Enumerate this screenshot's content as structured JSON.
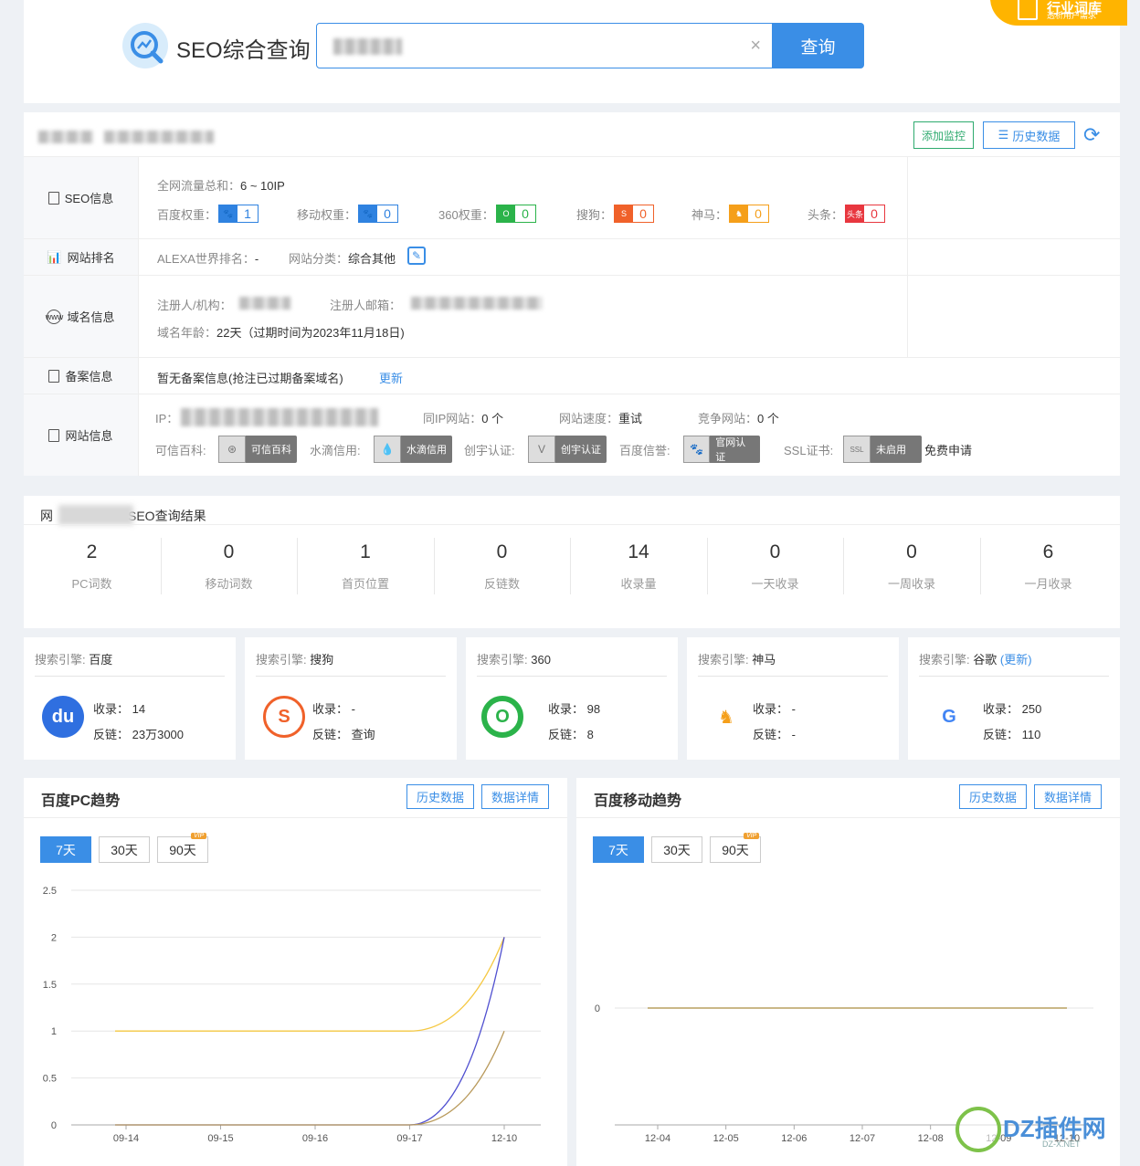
{
  "header": {
    "title": "SEO综合查询",
    "search_value": "",
    "clear_icon": "×",
    "search_button": "查询",
    "industry_badge_title": "行业词库",
    "industry_badge_sub": "透析用户需求"
  },
  "info": {
    "add_monitor": "添加监控",
    "history": "历史数据",
    "refresh_icon": "⟳",
    "seo_label": "SEO信息",
    "traffic_label": "全网流量总和：",
    "traffic_value": "6 ~ 10IP",
    "weights": [
      {
        "label": "百度权重：",
        "value": "1",
        "color": "#2f82e0",
        "icon": "baidu-paw-icon"
      },
      {
        "label": "移动权重：",
        "value": "0",
        "color": "#2f82e0",
        "icon": "baidu-paw-icon"
      },
      {
        "label": "360权重：",
        "value": "0",
        "color": "#2bb34a",
        "icon": "360-icon"
      },
      {
        "label": "搜狗：",
        "value": "0",
        "color": "#f0612a",
        "icon": "sogou-icon"
      },
      {
        "label": "神马：",
        "value": "0",
        "color": "#f59f1a",
        "icon": "shenma-icon"
      },
      {
        "label": "头条：",
        "value": "0",
        "color": "#e8373f",
        "icon": "toutiao-icon"
      }
    ],
    "rank_label": "网站排名",
    "alexa_label": "ALEXA世界排名：",
    "alexa_value": "-",
    "category_label": "网站分类：",
    "category_value": "综合其他",
    "domain_label": "域名信息",
    "registrant_label": "注册人/机构：",
    "email_label": "注册人邮箱：",
    "age_label": "域名年龄：",
    "age_value": "22天（过期时间为2023年11月18日)",
    "beian_label": "备案信息",
    "beian_value": "暂无备案信息(抢注已过期备案域名)",
    "beian_update": "更新",
    "site_label": "网站信息",
    "ip_label": "IP：",
    "same_ip_label": "同IP网站：",
    "same_ip_value": "0 个",
    "speed_label": "网站速度：",
    "speed_value": "重试",
    "competitor_label": "竞争网站：",
    "competitor_value": "0 个",
    "certs": [
      {
        "label": "可信百科:",
        "badge": "可信百科"
      },
      {
        "label": "水滴信用:",
        "badge": "水滴信用"
      },
      {
        "label": "创宇认证:",
        "badge": "创宇认证"
      },
      {
        "label": "百度信誉:",
        "badge": "官网认证"
      },
      {
        "label": "SSL证书:",
        "badge": "未启用"
      }
    ],
    "free_apply": "免费申请"
  },
  "results": {
    "title_prefix": "网",
    "title_suffix": "SEO查询结果",
    "stats": [
      {
        "value": "2",
        "label": "PC词数"
      },
      {
        "value": "0",
        "label": "移动词数"
      },
      {
        "value": "1",
        "label": "首页位置"
      },
      {
        "value": "0",
        "label": "反链数"
      },
      {
        "value": "14",
        "label": "收录量"
      },
      {
        "value": "0",
        "label": "一天收录"
      },
      {
        "value": "0",
        "label": "一周收录"
      },
      {
        "value": "6",
        "label": "一月收录"
      }
    ]
  },
  "engines": [
    {
      "prefix": "搜索引擎:",
      "name": "百度",
      "update": "",
      "index_label": "收录：",
      "index": "14",
      "link_label": "反链：",
      "links": "23万3000"
    },
    {
      "prefix": "搜索引擎:",
      "name": "搜狗",
      "update": "",
      "index_label": "收录：",
      "index": "-",
      "link_label": "反链：",
      "links": "查询"
    },
    {
      "prefix": "搜索引擎:",
      "name": "360",
      "update": "",
      "index_label": "收录：",
      "index": "98",
      "link_label": "反链：",
      "links": "8"
    },
    {
      "prefix": "搜索引擎:",
      "name": "神马",
      "update": "",
      "index_label": "收录：",
      "index": "-",
      "link_label": "反链：",
      "links": "-"
    },
    {
      "prefix": "搜索引擎:",
      "name": "谷歌",
      "update": "(更新)",
      "index_label": "收录：",
      "index": "250",
      "link_label": "反链：",
      "links": "110"
    }
  ],
  "trends": {
    "pc": {
      "title": "百度PC趋势",
      "history": "历史数据",
      "detail": "数据详情",
      "ranges": [
        "7天",
        "30天",
        "90天"
      ],
      "vip": "VIP"
    },
    "mobile": {
      "title": "百度移动趋势",
      "history": "历史数据",
      "detail": "数据详情",
      "ranges": [
        "7天",
        "30天",
        "90天"
      ],
      "vip": "VIP"
    }
  },
  "chart_data": [
    {
      "type": "line",
      "x": [
        "09-14",
        "09-15",
        "09-16",
        "09-17",
        "12-10"
      ],
      "y_ticks": [
        "0",
        "0.5",
        "1",
        "1.5",
        "2",
        "2.5"
      ],
      "ylim": [
        0,
        2.5
      ],
      "series": [
        {
          "color": "#f5c842",
          "values": [
            1,
            1,
            1,
            1,
            2
          ]
        },
        {
          "color": "#5050d0",
          "values": [
            0,
            0,
            0,
            0,
            2
          ]
        },
        {
          "color": "#b8995a",
          "values": [
            0,
            0,
            0,
            0,
            1
          ]
        }
      ]
    },
    {
      "type": "line",
      "x": [
        "12-04",
        "12-05",
        "12-06",
        "12-07",
        "12-08",
        "12-09",
        "12-10"
      ],
      "y_ticks": [
        "0"
      ],
      "series": [
        {
          "color": "#b8a060",
          "values": [
            0,
            0,
            0,
            0,
            0,
            0,
            0
          ]
        }
      ]
    }
  ],
  "watermark": {
    "text": "DZ插件网",
    "sub": "DZ-X.NET"
  }
}
